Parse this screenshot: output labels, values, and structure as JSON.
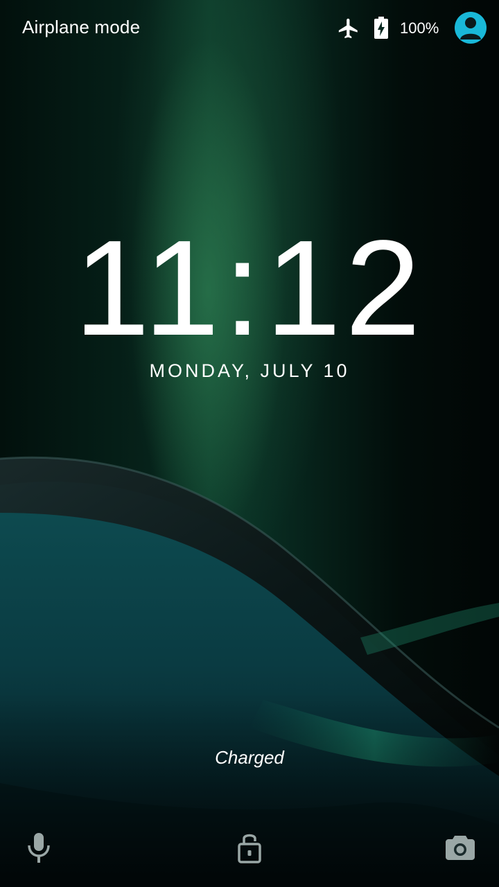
{
  "status_bar": {
    "carrier_text": "Airplane mode",
    "battery_percent": "100%",
    "icons": [
      "airplane-icon",
      "battery-charging-icon",
      "user-avatar-icon"
    ],
    "avatar_color": "#19b8d8"
  },
  "lock_screen": {
    "time": "11:12",
    "date": "MONDAY, JULY 10",
    "charge_status": "Charged"
  },
  "bottom_actions": {
    "left_icon": "microphone-icon",
    "center_icon": "unlock-icon",
    "right_icon": "camera-icon",
    "icon_color": "#9aa7a6"
  }
}
